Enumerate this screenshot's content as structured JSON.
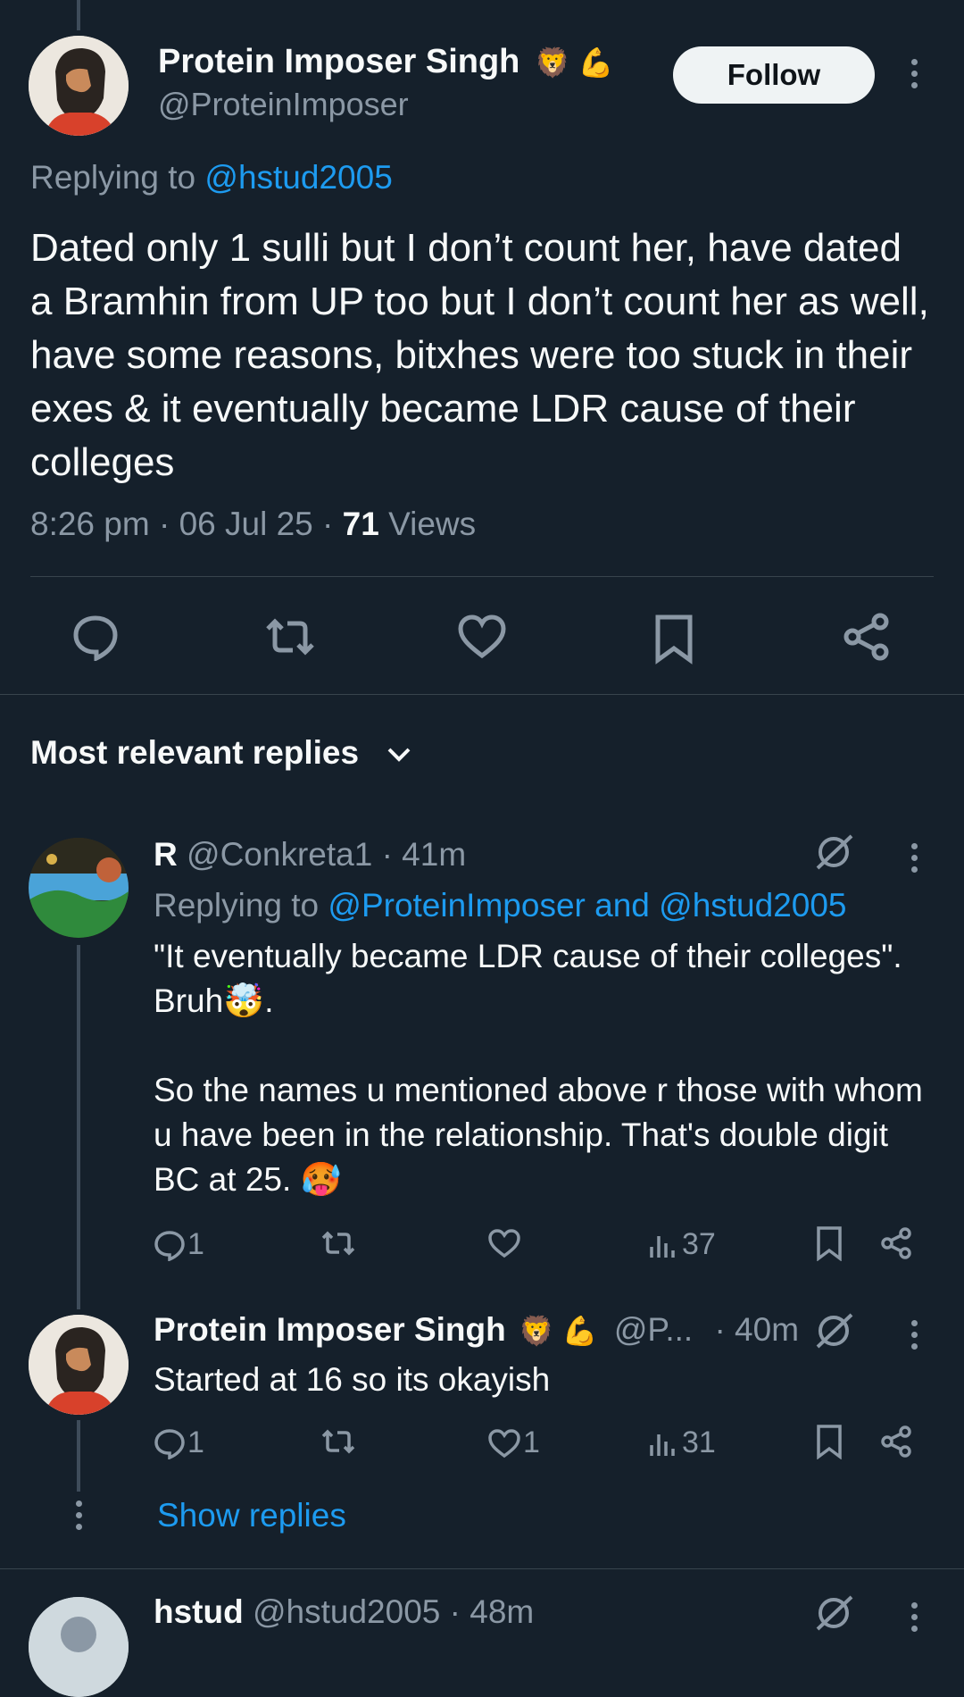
{
  "main_tweet": {
    "author_name": "Protein Imposer Singh",
    "author_emojis": "🦁 💪",
    "handle": "@ProteinImposer",
    "follow_label": "Follow",
    "replying_prefix": "Replying to",
    "replying_to": "@hstud2005",
    "text": "Dated only 1 sulli but I don’t count her, have dated a Bramhin from UP too but I don’t count her as well, have some reasons, bitxhes were too stuck in their exes & it eventually became LDR cause of their colleges",
    "time": "8:26 pm",
    "date": "06 Jul 25",
    "views_count": "71",
    "views_label": "Views"
  },
  "replies_header": {
    "label": "Most relevant replies"
  },
  "reply1": {
    "name": "R",
    "handle_time": "@Conkreta1 · 41m",
    "replying_prefix": "Replying to",
    "replying_to": "@ProteinImposer and @hstud2005",
    "line1": "\"It eventually became LDR cause of their colleges\".",
    "line2": "Bruh🤯.",
    "para2": "So the names u mentioned above r those with whom u have been in the relationship. That's double digit BC at 25. 🥵",
    "replies": "1",
    "likes": "",
    "views": "37"
  },
  "reply2": {
    "name": "Protein Imposer Singh",
    "emojis": "🦁 💪",
    "handle_short": "@P...",
    "time": "· 40m",
    "text": "Started at 16 so its okayish",
    "replies": "1",
    "likes": "1",
    "views": "31"
  },
  "show_replies": "Show replies",
  "reply3": {
    "name": "hstud",
    "handle_time": "@hstud2005 · 48m"
  }
}
